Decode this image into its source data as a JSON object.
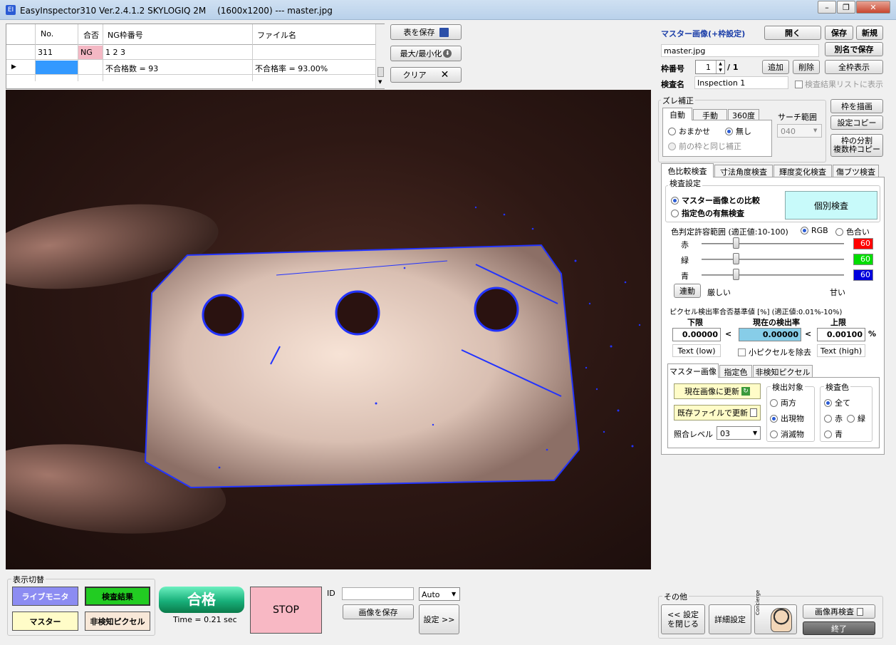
{
  "window": {
    "title": "EasyInspector310 Ver.2.4.1.2 SKYLOGIQ 2M　 (1600x1200) --- master.jpg"
  },
  "table": {
    "headers": [
      "No.",
      "合否",
      "NG枠番号",
      "ファイル名"
    ],
    "rows": [
      {
        "no": "311",
        "result": "NG",
        "ng_frames": "1 2 3",
        "file": ""
      },
      {
        "no": "",
        "result": "",
        "ng_frames": "不合格数 = 93",
        "file": "不合格率 = 93.00%"
      }
    ]
  },
  "table_buttons": {
    "save_table": "表を保存",
    "maximize": "最大/最小化",
    "clear": "クリア"
  },
  "master": {
    "label": "マスター画像(+枠設定)",
    "open": "開く",
    "save": "保存",
    "new": "新規",
    "filename": "master.jpg",
    "save_as": "別名で保存",
    "frame_label": "枠番号",
    "frame_value": "1",
    "frame_total": "/ 1",
    "add": "追加",
    "delete": "削除",
    "show_all": "全枠表示",
    "inspection_label": "検査名",
    "inspection_value": "Inspection 1",
    "show_in_list": "検査結果リストに表示"
  },
  "offset": {
    "title": "ズレ補正",
    "tabs": [
      "自動",
      "手動",
      "360度"
    ],
    "opt_auto": "おまかせ",
    "opt_none": "無し",
    "opt_same": "前の枠と同じ補正",
    "search_label": "サーチ範囲",
    "search_value": "040",
    "draw_frame": "枠を描画",
    "copy_settings": "設定コピー",
    "split_line1": "枠の分割",
    "split_line2": "複数枠コピー"
  },
  "insp_tabs": [
    "色比較検査",
    "寸法角度検査",
    "輝度変化検査",
    "傷ブツ検査"
  ],
  "color_insp": {
    "settings_title": "検査設定",
    "opt_master": "マスター画像との比較",
    "opt_color": "指定色の有無検査",
    "individual": "個別検査",
    "tolerance_label": "色判定許容範囲 (適正値:10-100)",
    "rgb": "RGB",
    "hue": "色合い",
    "red_label": "赤",
    "green_label": "緑",
    "blue_label": "青",
    "red_value": "60",
    "green_value": "60",
    "blue_value": "60",
    "red_color": "#ff0000",
    "green_color": "#00dd00",
    "blue_color": "#0000dd",
    "link": "連動",
    "strict": "厳しい",
    "loose": "甘い",
    "pixel_title": "ピクセル検出率合否基準値 [%] (適正値:0.01%-10%)",
    "lower_label": "下限",
    "current_label": "現在の検出率",
    "upper_label": "上限",
    "lower_value": "0.00000",
    "current_value": "0.00000",
    "upper_value": "0.00100",
    "lt1": "<",
    "lt2": "<",
    "pct": "%",
    "text_low": "Text (low)",
    "remove_small": "小ピクセルを除去",
    "text_high": "Text (high)"
  },
  "sub_tabs": [
    "マスター画像",
    "指定色",
    "非検知ピクセル"
  ],
  "master_tab": {
    "update_current": "現在画像に更新",
    "update_existing": "既存ファイルで更新",
    "match_label": "照合レベル",
    "match_value": "03",
    "target_title": "検出対象",
    "target_both": "両方",
    "target_appear": "出現物",
    "target_vanish": "消滅物",
    "color_title": "検査色",
    "color_all": "全て",
    "color_red": "赤",
    "color_green": "緑",
    "color_blue": "青"
  },
  "display_switch": {
    "title": "表示切替",
    "live": "ライブモニタ",
    "result": "検査結果",
    "master": "マスター",
    "undetect": "非検知ピクセル"
  },
  "status": {
    "verdict": "合格",
    "time": "Time = 0.21 sec",
    "stop": "STOP",
    "id_label": "ID",
    "id_value": "",
    "mode": "Auto",
    "save_image": "画像を保存",
    "settings": "設定 >>"
  },
  "other": {
    "title": "その他",
    "close_settings_1": "<< 設定",
    "close_settings_2": "を閉じる",
    "detail": "詳細設定",
    "concierge": "Concierge",
    "reinspect": "画像再検査",
    "quit": "終了"
  }
}
